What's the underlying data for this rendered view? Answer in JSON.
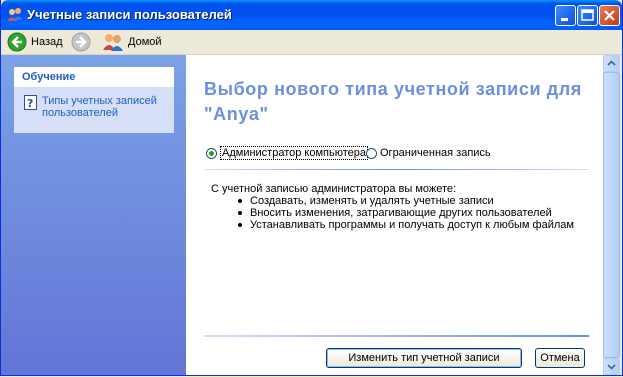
{
  "window": {
    "title": "Учетные записи пользователей",
    "icon": "users-icon"
  },
  "toolbar": {
    "back_label": "Назад",
    "home_label": "Домой"
  },
  "sidebar": {
    "panel_title": "Обучение",
    "links": [
      {
        "label": "Типы учетных записей пользователей",
        "icon": "help-icon"
      }
    ]
  },
  "main": {
    "heading": "Выбор нового типа учетной записи для \"Anya\"",
    "options": [
      {
        "label": "Администратор компьютера",
        "selected": true
      },
      {
        "label": "Ограниченная запись",
        "selected": false
      }
    ],
    "description": "С учетной записью администратора вы можете:",
    "bullets": [
      "Создавать, изменять и удалять учетные записи",
      "Вносить изменения, затрагивающие других пользователей",
      "Устанавливать программы и получать доступ к любым файлам"
    ],
    "change_button": "Изменить тип учетной записи",
    "cancel_button": "Отмена"
  },
  "colors": {
    "titlebar": "#0054e3",
    "heading": "#6c8ee3",
    "link": "#215dc6",
    "sidebar": "#6f8ce0"
  }
}
